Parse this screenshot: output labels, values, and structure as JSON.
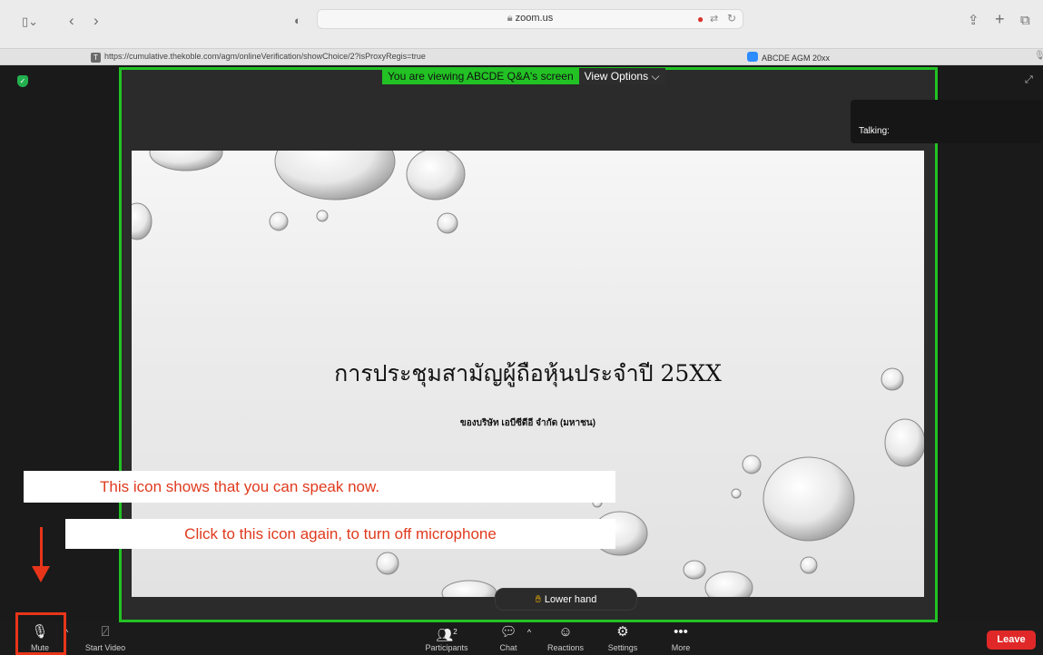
{
  "browser": {
    "address_host": "zoom.us",
    "tab_url": "https://cumulative.thekoble.com/agm/onlineVerification/showChoice/2?isProxyRegis=true",
    "tab_url_favicon": "T",
    "tab_zoom_title": "ABCDE AGM 20xx"
  },
  "meeting": {
    "viewing_text": "You are viewing ABCDE Q&A's screen",
    "view_options": "View Options ⌵",
    "talking_label": "Talking:"
  },
  "slide": {
    "title": "การประชุมสามัญผู้ถือหุ้นประจำปี 25XX",
    "subtitle": "ของบริษัท เอบีซีดีอี จำกัด (มหาชน)"
  },
  "annotations": {
    "note1": "This icon shows that you can speak now.",
    "note2": "Click to this icon again, to turn off microphone"
  },
  "lower_hand": "Lower hand",
  "controls": {
    "mute": "Mute",
    "start_video": "Start Video",
    "participants": "Participants",
    "participants_count": "2",
    "chat": "Chat",
    "reactions": "Reactions",
    "settings": "Settings",
    "more": "More",
    "leave": "Leave"
  },
  "colors": {
    "share_border": "#22c224",
    "annotation_red": "#e03a1e",
    "leave_red": "#e02828"
  }
}
